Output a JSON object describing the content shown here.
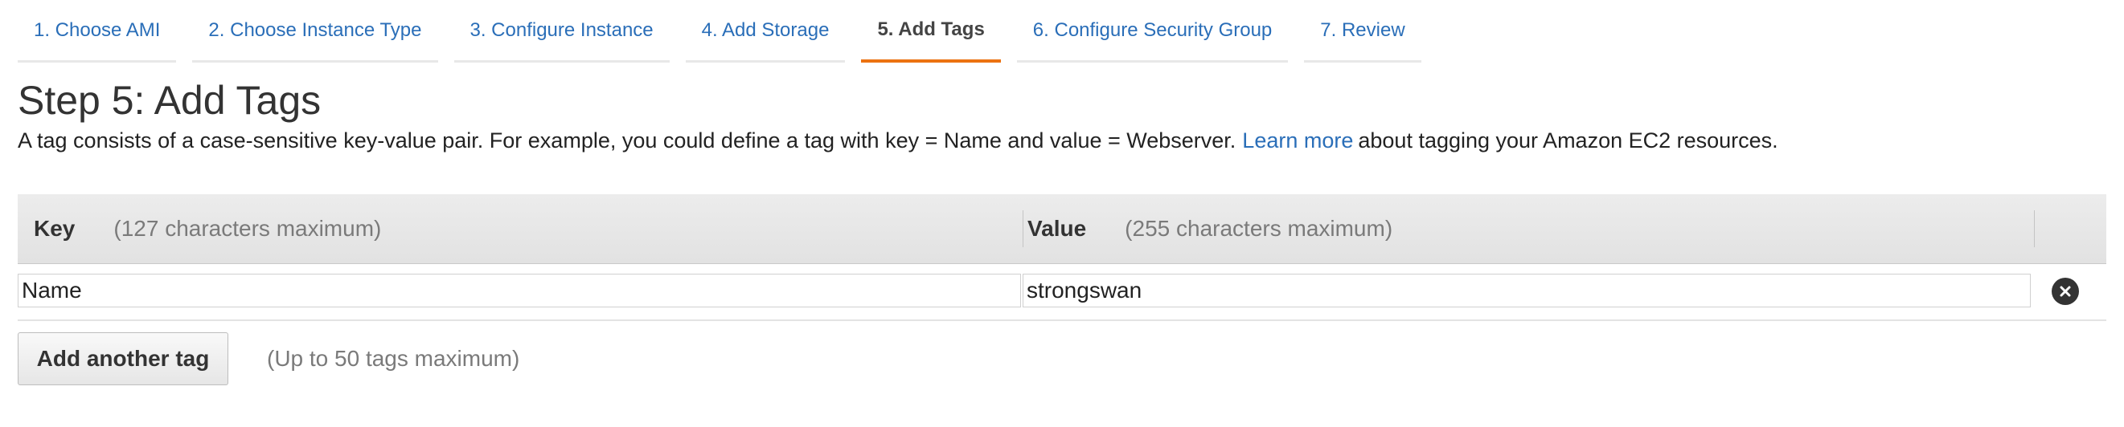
{
  "wizard": {
    "tabs": [
      {
        "label": "1. Choose AMI"
      },
      {
        "label": "2. Choose Instance Type"
      },
      {
        "label": "3. Configure Instance"
      },
      {
        "label": "4. Add Storage"
      },
      {
        "label": "5. Add Tags"
      },
      {
        "label": "6. Configure Security Group"
      },
      {
        "label": "7. Review"
      }
    ],
    "active_tab": "5. Add Tags"
  },
  "page": {
    "title": "Step 5: Add Tags",
    "description_before": "A tag consists of a case-sensitive key-value pair. For example, you could define a tag with key = Name and value = Webserver.",
    "learn_more": "Learn more",
    "description_after": "about tagging your Amazon EC2 resources."
  },
  "table": {
    "key_header": "Key",
    "key_hint": "(127 characters maximum)",
    "value_header": "Value",
    "value_hint": "(255 characters maximum)",
    "rows": [
      {
        "key": "Name",
        "value": "strongswan"
      }
    ]
  },
  "add_tag": {
    "button_label": "Add another tag",
    "hint": "(Up to 50 tags maximum)"
  },
  "icons": {
    "remove": "close-circle-icon"
  },
  "colors": {
    "link": "#2a6eb8",
    "active_tab_underline": "#ec7211",
    "header_background": "#e6e6e6"
  }
}
